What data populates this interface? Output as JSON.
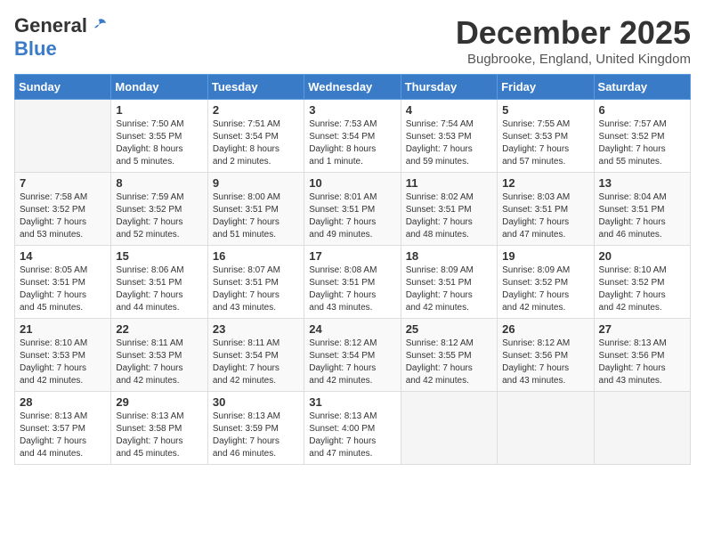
{
  "logo": {
    "general": "General",
    "blue": "Blue"
  },
  "header": {
    "month": "December 2025",
    "location": "Bugbrooke, England, United Kingdom"
  },
  "weekdays": [
    "Sunday",
    "Monday",
    "Tuesday",
    "Wednesday",
    "Thursday",
    "Friday",
    "Saturday"
  ],
  "weeks": [
    [
      {
        "day": "",
        "info": ""
      },
      {
        "day": "1",
        "info": "Sunrise: 7:50 AM\nSunset: 3:55 PM\nDaylight: 8 hours\nand 5 minutes."
      },
      {
        "day": "2",
        "info": "Sunrise: 7:51 AM\nSunset: 3:54 PM\nDaylight: 8 hours\nand 2 minutes."
      },
      {
        "day": "3",
        "info": "Sunrise: 7:53 AM\nSunset: 3:54 PM\nDaylight: 8 hours\nand 1 minute."
      },
      {
        "day": "4",
        "info": "Sunrise: 7:54 AM\nSunset: 3:53 PM\nDaylight: 7 hours\nand 59 minutes."
      },
      {
        "day": "5",
        "info": "Sunrise: 7:55 AM\nSunset: 3:53 PM\nDaylight: 7 hours\nand 57 minutes."
      },
      {
        "day": "6",
        "info": "Sunrise: 7:57 AM\nSunset: 3:52 PM\nDaylight: 7 hours\nand 55 minutes."
      }
    ],
    [
      {
        "day": "7",
        "info": "Sunrise: 7:58 AM\nSunset: 3:52 PM\nDaylight: 7 hours\nand 53 minutes."
      },
      {
        "day": "8",
        "info": "Sunrise: 7:59 AM\nSunset: 3:52 PM\nDaylight: 7 hours\nand 52 minutes."
      },
      {
        "day": "9",
        "info": "Sunrise: 8:00 AM\nSunset: 3:51 PM\nDaylight: 7 hours\nand 51 minutes."
      },
      {
        "day": "10",
        "info": "Sunrise: 8:01 AM\nSunset: 3:51 PM\nDaylight: 7 hours\nand 49 minutes."
      },
      {
        "day": "11",
        "info": "Sunrise: 8:02 AM\nSunset: 3:51 PM\nDaylight: 7 hours\nand 48 minutes."
      },
      {
        "day": "12",
        "info": "Sunrise: 8:03 AM\nSunset: 3:51 PM\nDaylight: 7 hours\nand 47 minutes."
      },
      {
        "day": "13",
        "info": "Sunrise: 8:04 AM\nSunset: 3:51 PM\nDaylight: 7 hours\nand 46 minutes."
      }
    ],
    [
      {
        "day": "14",
        "info": "Sunrise: 8:05 AM\nSunset: 3:51 PM\nDaylight: 7 hours\nand 45 minutes."
      },
      {
        "day": "15",
        "info": "Sunrise: 8:06 AM\nSunset: 3:51 PM\nDaylight: 7 hours\nand 44 minutes."
      },
      {
        "day": "16",
        "info": "Sunrise: 8:07 AM\nSunset: 3:51 PM\nDaylight: 7 hours\nand 43 minutes."
      },
      {
        "day": "17",
        "info": "Sunrise: 8:08 AM\nSunset: 3:51 PM\nDaylight: 7 hours\nand 43 minutes."
      },
      {
        "day": "18",
        "info": "Sunrise: 8:09 AM\nSunset: 3:51 PM\nDaylight: 7 hours\nand 42 minutes."
      },
      {
        "day": "19",
        "info": "Sunrise: 8:09 AM\nSunset: 3:52 PM\nDaylight: 7 hours\nand 42 minutes."
      },
      {
        "day": "20",
        "info": "Sunrise: 8:10 AM\nSunset: 3:52 PM\nDaylight: 7 hours\nand 42 minutes."
      }
    ],
    [
      {
        "day": "21",
        "info": "Sunrise: 8:10 AM\nSunset: 3:53 PM\nDaylight: 7 hours\nand 42 minutes."
      },
      {
        "day": "22",
        "info": "Sunrise: 8:11 AM\nSunset: 3:53 PM\nDaylight: 7 hours\nand 42 minutes."
      },
      {
        "day": "23",
        "info": "Sunrise: 8:11 AM\nSunset: 3:54 PM\nDaylight: 7 hours\nand 42 minutes."
      },
      {
        "day": "24",
        "info": "Sunrise: 8:12 AM\nSunset: 3:54 PM\nDaylight: 7 hours\nand 42 minutes."
      },
      {
        "day": "25",
        "info": "Sunrise: 8:12 AM\nSunset: 3:55 PM\nDaylight: 7 hours\nand 42 minutes."
      },
      {
        "day": "26",
        "info": "Sunrise: 8:12 AM\nSunset: 3:56 PM\nDaylight: 7 hours\nand 43 minutes."
      },
      {
        "day": "27",
        "info": "Sunrise: 8:13 AM\nSunset: 3:56 PM\nDaylight: 7 hours\nand 43 minutes."
      }
    ],
    [
      {
        "day": "28",
        "info": "Sunrise: 8:13 AM\nSunset: 3:57 PM\nDaylight: 7 hours\nand 44 minutes."
      },
      {
        "day": "29",
        "info": "Sunrise: 8:13 AM\nSunset: 3:58 PM\nDaylight: 7 hours\nand 45 minutes."
      },
      {
        "day": "30",
        "info": "Sunrise: 8:13 AM\nSunset: 3:59 PM\nDaylight: 7 hours\nand 46 minutes."
      },
      {
        "day": "31",
        "info": "Sunrise: 8:13 AM\nSunset: 4:00 PM\nDaylight: 7 hours\nand 47 minutes."
      },
      {
        "day": "",
        "info": ""
      },
      {
        "day": "",
        "info": ""
      },
      {
        "day": "",
        "info": ""
      }
    ]
  ]
}
